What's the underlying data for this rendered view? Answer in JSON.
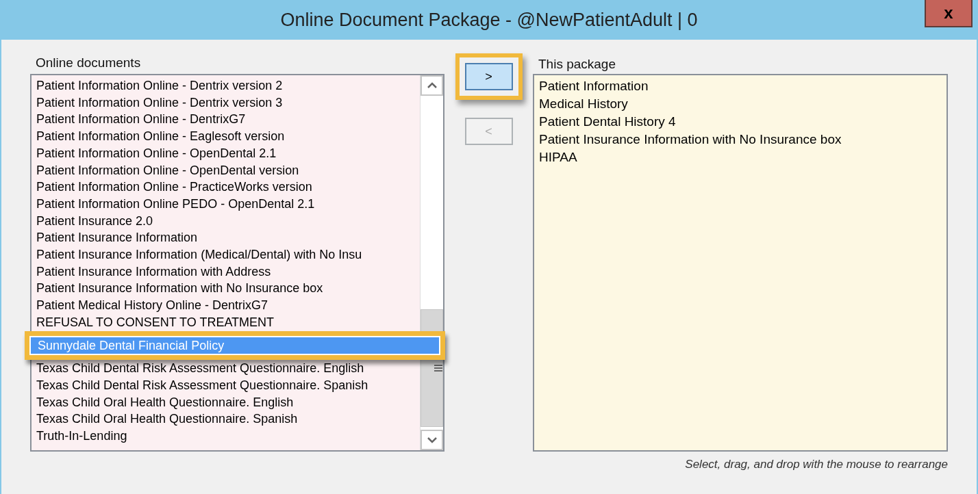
{
  "window": {
    "title": "Online Document Package - @NewPatientAdult | 0",
    "close_label": "x"
  },
  "online_documents": {
    "label": "Online documents",
    "items": [
      {
        "text": "Patient Information Online - Dentrix version 2",
        "selected": false,
        "callout": false
      },
      {
        "text": "Patient Information Online - Dentrix version 3",
        "selected": false,
        "callout": false
      },
      {
        "text": "Patient Information Online - DentrixG7",
        "selected": false,
        "callout": false
      },
      {
        "text": "Patient Information Online - Eaglesoft version",
        "selected": false,
        "callout": false
      },
      {
        "text": "Patient Information Online - OpenDental 2.1",
        "selected": false,
        "callout": false
      },
      {
        "text": "Patient Information Online - OpenDental version",
        "selected": false,
        "callout": false
      },
      {
        "text": "Patient Information Online - PracticeWorks version",
        "selected": false,
        "callout": false
      },
      {
        "text": "Patient Information Online PEDO - OpenDental 2.1",
        "selected": false,
        "callout": false
      },
      {
        "text": "Patient Insurance 2.0",
        "selected": false,
        "callout": false
      },
      {
        "text": "Patient Insurance Information",
        "selected": false,
        "callout": false
      },
      {
        "text": "Patient Insurance Information (Medical/Dental) with No Insu",
        "selected": false,
        "callout": false
      },
      {
        "text": "Patient Insurance Information with Address",
        "selected": false,
        "callout": false
      },
      {
        "text": "Patient Insurance Information with No Insurance box",
        "selected": false,
        "callout": false
      },
      {
        "text": "Patient Medical History Online - DentrixG7",
        "selected": false,
        "callout": false
      },
      {
        "text": "REFUSAL TO CONSENT TO TREATMENT",
        "selected": false,
        "callout": false
      },
      {
        "text": "Sunnydale Dental Financial Policy",
        "selected": true,
        "callout": true
      },
      {
        "text": "Texas Child Dental Risk Assessment Questionnaire. English",
        "selected": false,
        "callout": false
      },
      {
        "text": "Texas Child Dental Risk Assessment Questionnaire. Spanish",
        "selected": false,
        "callout": false
      },
      {
        "text": "Texas Child Oral Health Questionnaire. English",
        "selected": false,
        "callout": false
      },
      {
        "text": "Texas Child Oral Health Questionnaire. Spanish",
        "selected": false,
        "callout": false
      },
      {
        "text": "Truth-In-Lending",
        "selected": false,
        "callout": false
      }
    ]
  },
  "add_button": {
    "label": ">",
    "disabled": false,
    "callout": true
  },
  "remove_button": {
    "label": "<",
    "disabled": true,
    "callout": false
  },
  "this_package": {
    "label": "This package",
    "items": [
      "Patient Information",
      "Medical History",
      "Patient Dental History 4",
      "Patient Insurance Information with No Insurance box",
      "HIPAA"
    ],
    "hint": "Select, drag, and drop with the mouse to rearrange"
  }
}
